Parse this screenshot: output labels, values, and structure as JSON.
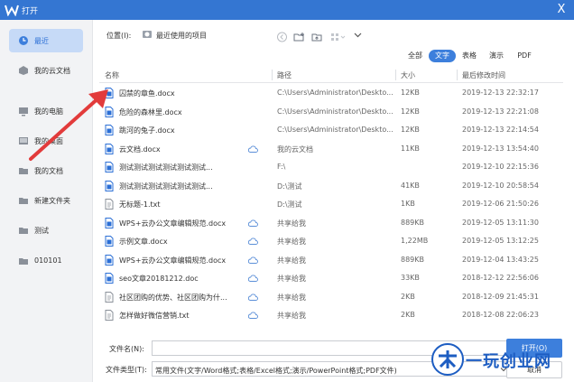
{
  "window": {
    "title": "打开",
    "close_label": "X"
  },
  "sidebar": {
    "items": [
      {
        "label": "最近",
        "icon": "clock-icon",
        "active": true
      },
      {
        "label": "我的云文档",
        "icon": "cloud-doc-icon"
      },
      {
        "label": "我的电脑",
        "icon": "computer-icon"
      },
      {
        "label": "我的桌面",
        "icon": "desktop-icon"
      },
      {
        "label": "我的文档",
        "icon": "folder-icon"
      },
      {
        "label": "新建文件夹",
        "icon": "folder-icon"
      },
      {
        "label": "测试",
        "icon": "folder-icon"
      },
      {
        "label": "010101",
        "icon": "folder-icon"
      }
    ]
  },
  "location": {
    "label": "位置(I):",
    "value": "最近使用的项目"
  },
  "filters": [
    {
      "label": "全部"
    },
    {
      "label": "文字",
      "active": true
    },
    {
      "label": "表格"
    },
    {
      "label": "演示"
    },
    {
      "label": "PDF"
    }
  ],
  "columns": {
    "name": "名称",
    "path": "路径",
    "size": "大小",
    "date": "最后修改时间"
  },
  "files": [
    {
      "name": "囚禁的章鱼.docx",
      "path": "C:\\Users\\Administrator\\Deskto...",
      "size": "12KB",
      "date": "2019-12-13 22:32:17",
      "cloud": false,
      "type": "docx"
    },
    {
      "name": "危险的森林里.docx",
      "path": "C:\\Users\\Administrator\\Deskto...",
      "size": "12KB",
      "date": "2019-12-13 22:21:08",
      "cloud": false,
      "type": "docx"
    },
    {
      "name": "跳河的兔子.docx",
      "path": "C:\\Users\\Administrator\\Deskto...",
      "size": "12KB",
      "date": "2019-12-13 22:14:54",
      "cloud": false,
      "type": "docx"
    },
    {
      "name": "云文档.docx",
      "path": "我的云文档",
      "size": "11KB",
      "date": "2019-12-13 13:54:40",
      "cloud": true,
      "type": "docx"
    },
    {
      "name": "测试测试测试测试测试测试...",
      "path": "F:\\",
      "size": "",
      "date": "2019-12-10 22:15:36",
      "cloud": false,
      "type": "docx"
    },
    {
      "name": "测试测试测试测试测试测试...",
      "path": "D:\\测试",
      "size": "41KB",
      "date": "2019-12-10 20:58:54",
      "cloud": false,
      "type": "docx"
    },
    {
      "name": "无标题-1.txt",
      "path": "D:\\测试",
      "size": "1KB",
      "date": "2019-12-06 21:50:26",
      "cloud": false,
      "type": "txt"
    },
    {
      "name": "WPS+云办公文章编辑规范.docx",
      "path": "共享给我",
      "size": "889KB",
      "date": "2019-12-05 13:11:30",
      "cloud": true,
      "type": "docx"
    },
    {
      "name": "示例文章.docx",
      "path": "共享给我",
      "size": "1,22MB",
      "date": "2019-12-05 13:12:25",
      "cloud": true,
      "type": "docx"
    },
    {
      "name": "WPS+云办公文章编辑规范.docx",
      "path": "共享给我",
      "size": "889KB",
      "date": "2019-12-04 13:43:25",
      "cloud": true,
      "type": "docx"
    },
    {
      "name": "seo文章20181212.doc",
      "path": "共享给我",
      "size": "33KB",
      "date": "2018-12-12 22:56:06",
      "cloud": true,
      "type": "docx"
    },
    {
      "name": "社区团购的优势、社区团购为什...",
      "path": "共享给我",
      "size": "2KB",
      "date": "2018-12-09 21:45:31",
      "cloud": true,
      "type": "txt"
    },
    {
      "name": "怎样做好微信营销.txt",
      "path": "共享给我",
      "size": "2KB",
      "date": "2018-12-08 22:06:23",
      "cloud": true,
      "type": "txt"
    }
  ],
  "bottom": {
    "filename_label": "文件名(N):",
    "filename_value": "",
    "filetype_label": "文件类型(T):",
    "filetype_value": "常用文件(文字/Word格式;表格/Excel格式;演示/PowerPoint格式;PDF文件)",
    "open_label": "打开(O)",
    "cancel_label": "取消"
  },
  "watermark": {
    "text": "一玩创业网"
  },
  "colors": {
    "accent": "#3d7fdc",
    "titlebar": "#3476d2",
    "sidebar_active": "#c6daf7",
    "arrow": "#e23b3b"
  }
}
